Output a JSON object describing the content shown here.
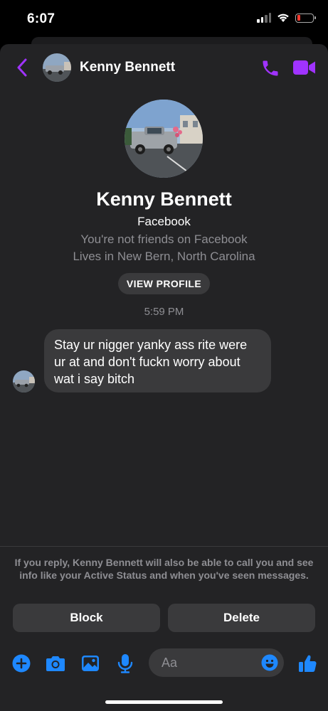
{
  "status_bar": {
    "time": "6:07"
  },
  "header": {
    "name": "Kenny Bennett",
    "back_icon": "chevron-left-icon",
    "call_icon": "phone-icon",
    "video_icon": "video-camera-icon"
  },
  "profile": {
    "name": "Kenny Bennett",
    "source": "Facebook",
    "friend_status": "You're not friends on Facebook",
    "location": "Lives in New Bern, North Carolina",
    "view_profile_label": "VIEW PROFILE"
  },
  "conversation": {
    "timestamp": "5:59 PM",
    "messages": [
      {
        "text": "Stay ur nigger yanky ass rite were ur at and don't fuckn worry about wat i say bitch"
      }
    ]
  },
  "request": {
    "notice": "If you reply, Kenny Bennett will also be able to call you and see info like your Active Status and when you've seen messages.",
    "block_label": "Block",
    "delete_label": "Delete"
  },
  "composer": {
    "placeholder": "Aa",
    "icons": [
      "plus-icon",
      "camera-icon",
      "image-icon",
      "microphone-icon",
      "emoji-icon",
      "thumbs-up-icon"
    ]
  },
  "colors": {
    "accent_purple": "#a033ff",
    "accent_blue": "#1e88ff",
    "background": "#232325",
    "bubble": "#3a3a3c",
    "secondary_text": "#8e8e93"
  }
}
